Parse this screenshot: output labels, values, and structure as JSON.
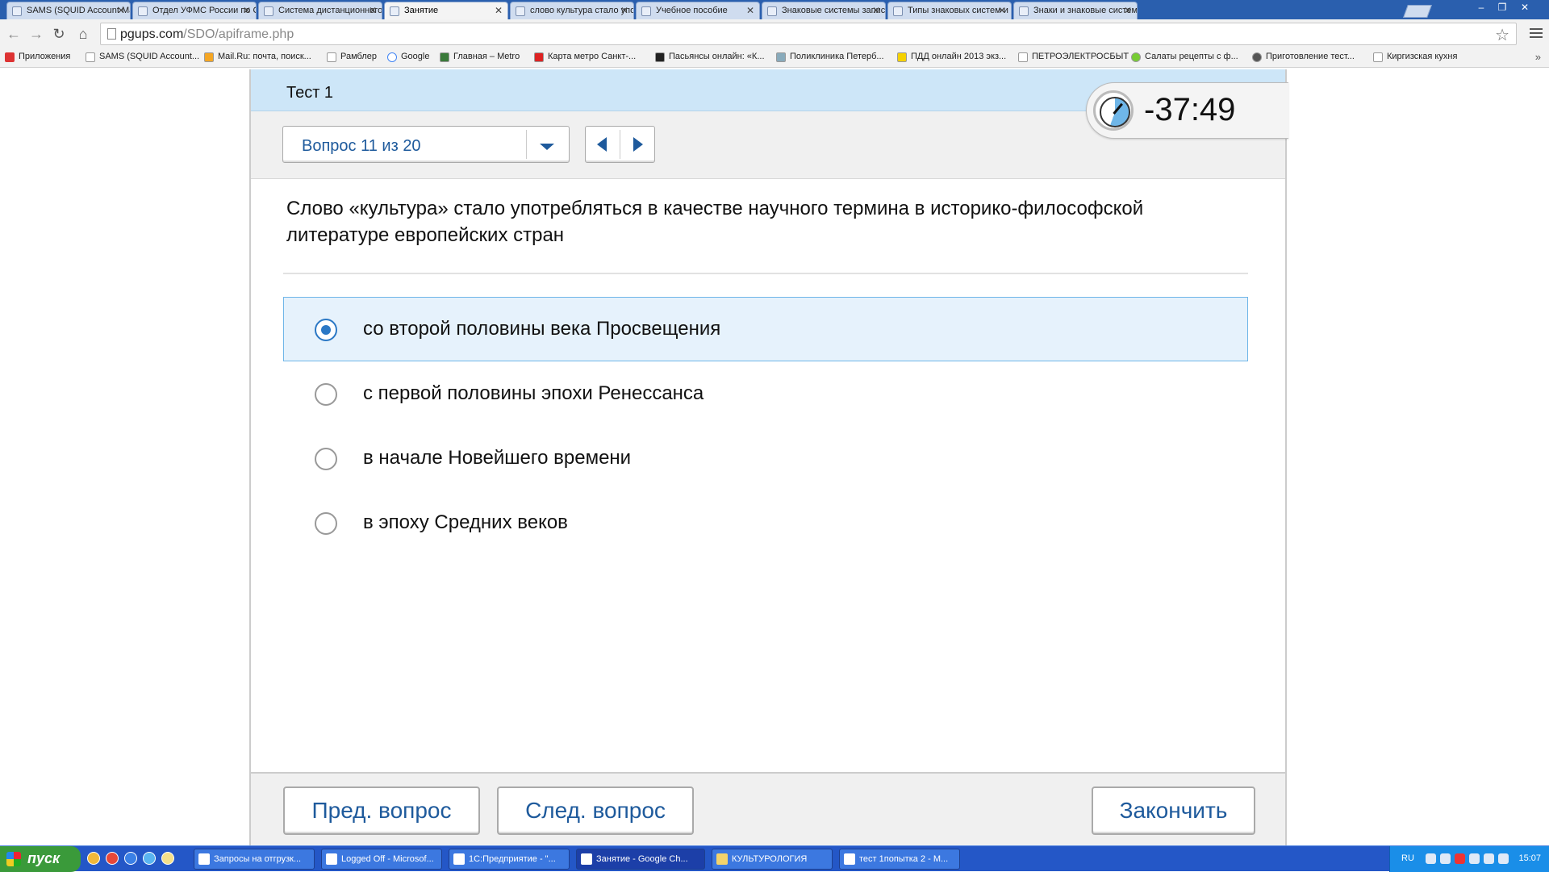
{
  "browser": {
    "tabs": [
      {
        "title": "SAMS (SQUID Account Mana",
        "active": false
      },
      {
        "title": "Отдел УФМС России по Са",
        "active": false
      },
      {
        "title": "Система дистанционного о",
        "active": false
      },
      {
        "title": "Занятие",
        "active": true
      },
      {
        "title": "слово культура стало упот",
        "active": false
      },
      {
        "title": "Учебное пособие",
        "active": false
      },
      {
        "title": "Знаковые системы записи",
        "active": false
      },
      {
        "title": "Типы знаковых систем и их",
        "active": false
      },
      {
        "title": "Знаки и знаковые системы",
        "active": false
      }
    ],
    "url": {
      "host": "pgups.com",
      "path": "/SDO/apiframe.php"
    },
    "bookmarks": [
      "Приложения",
      "SAMS (SQUID Account...",
      "Mail.Ru: почта, поиск...",
      "Рамблер",
      "Google",
      "Главная – Metro",
      "Карта метро Санкт-...",
      "Пасьянсы онлайн: «К...",
      "Поликлиника Петерб...",
      "ПДД онлайн 2013 экз...",
      "ПЕТРОЭЛЕКТРОСБЫТ",
      "Салаты рецепты с ф...",
      "Приготовление тест...",
      "Киргизская кухня"
    ]
  },
  "test": {
    "title": "Тест 1",
    "question_selector": "Вопрос 11 из 20",
    "timer": "-37:49",
    "question": "Слово «культура» стало употребляться в качестве научного термина в историко-философской литературе европейских стран",
    "answers": [
      {
        "label": "со второй половины века Просвещения",
        "selected": true
      },
      {
        "label": "с первой половины эпохи Ренессанса",
        "selected": false
      },
      {
        "label": "в начале Новейшего времени",
        "selected": false
      },
      {
        "label": "в эпоху Средних веков",
        "selected": false
      }
    ],
    "footer": {
      "prev": "Пред. вопрос",
      "next": "След. вопрос",
      "finish": "Закончить"
    }
  },
  "taskbar": {
    "start": "пуск",
    "tasks": [
      {
        "label": "Запросы на отгрузк...",
        "active": false
      },
      {
        "label": "Logged Off - Microsof...",
        "active": false
      },
      {
        "label": "1С:Предприятие - \"...",
        "active": false
      },
      {
        "label": "Занятие - Google Ch...",
        "active": true
      },
      {
        "label": "КУЛЬТУРОЛОГИЯ",
        "active": false
      },
      {
        "label": "тест 1попытка 2 - М...",
        "active": false
      }
    ],
    "lang": "RU",
    "clock": "15:07"
  },
  "colors": {
    "header_bg": "#cde6f8",
    "accent": "#1e5a9c",
    "selected_answer_bg": "#e6f2fc",
    "radio_selected": "#2b78c5"
  }
}
